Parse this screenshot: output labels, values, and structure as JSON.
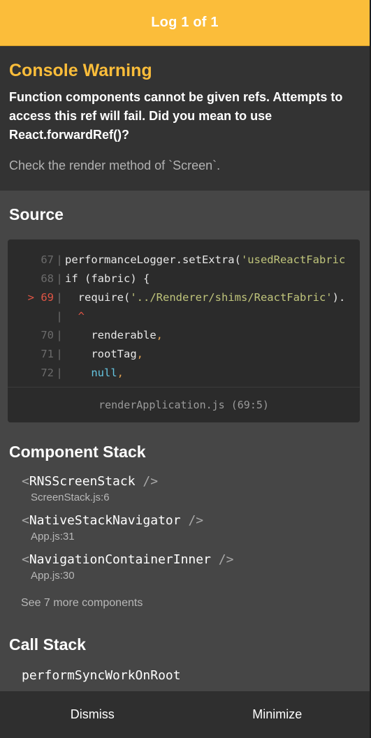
{
  "header": {
    "title": "Log 1 of 1"
  },
  "warning": {
    "title": "Console Warning",
    "message": "Function components cannot be given refs. Attempts to access this ref will fail. Did you mean to use React.forwardRef()?",
    "detail": "Check the render method of `Screen`."
  },
  "source": {
    "heading": "Source",
    "lines": [
      {
        "num": "67",
        "marker": "",
        "segments": [
          {
            "t": "performanceLogger.setExtra(",
            "c": "plain"
          },
          {
            "t": "'usedReactFabric",
            "c": "str"
          }
        ]
      },
      {
        "num": "68",
        "marker": "",
        "segments": [
          {
            "t": "if (fabric) {",
            "c": "plain"
          }
        ]
      },
      {
        "num": "69",
        "marker": ">",
        "segments": [
          {
            "t": "  require(",
            "c": "plain"
          },
          {
            "t": "'../Renderer/shims/ReactFabric'",
            "c": "str"
          },
          {
            "t": ").",
            "c": "plain"
          }
        ]
      },
      {
        "num": "",
        "marker": "",
        "segments": [
          {
            "t": "  ^",
            "c": "caret"
          }
        ]
      },
      {
        "num": "70",
        "marker": "",
        "segments": [
          {
            "t": "    renderable",
            "c": "plain"
          },
          {
            "t": ",",
            "c": "punc"
          }
        ]
      },
      {
        "num": "71",
        "marker": "",
        "segments": [
          {
            "t": "    rootTag",
            "c": "plain"
          },
          {
            "t": ",",
            "c": "punc"
          }
        ]
      },
      {
        "num": "72",
        "marker": "",
        "segments": [
          {
            "t": "    null",
            "c": "kw"
          },
          {
            "t": ",",
            "c": "punc"
          }
        ]
      }
    ],
    "file": "renderApplication.js (69:5)"
  },
  "component_stack": {
    "heading": "Component Stack",
    "frames": [
      {
        "name": "RNSScreenStack",
        "file": "ScreenStack.js:6"
      },
      {
        "name": "NativeStackNavigator",
        "file": "App.js:31"
      },
      {
        "name": "NavigationContainerInner",
        "file": "App.js:30"
      }
    ],
    "see_more": "See 7 more components"
  },
  "call_stack": {
    "heading": "Call Stack",
    "frames": [
      "performSyncWorkOnRoot"
    ]
  },
  "footer": {
    "dismiss_label": "Dismiss",
    "minimize_label": "Minimize"
  },
  "colors": {
    "accent": "#fbbd3a",
    "panel": "#333333",
    "body": "#464646",
    "footer": "#2f2f2f"
  }
}
